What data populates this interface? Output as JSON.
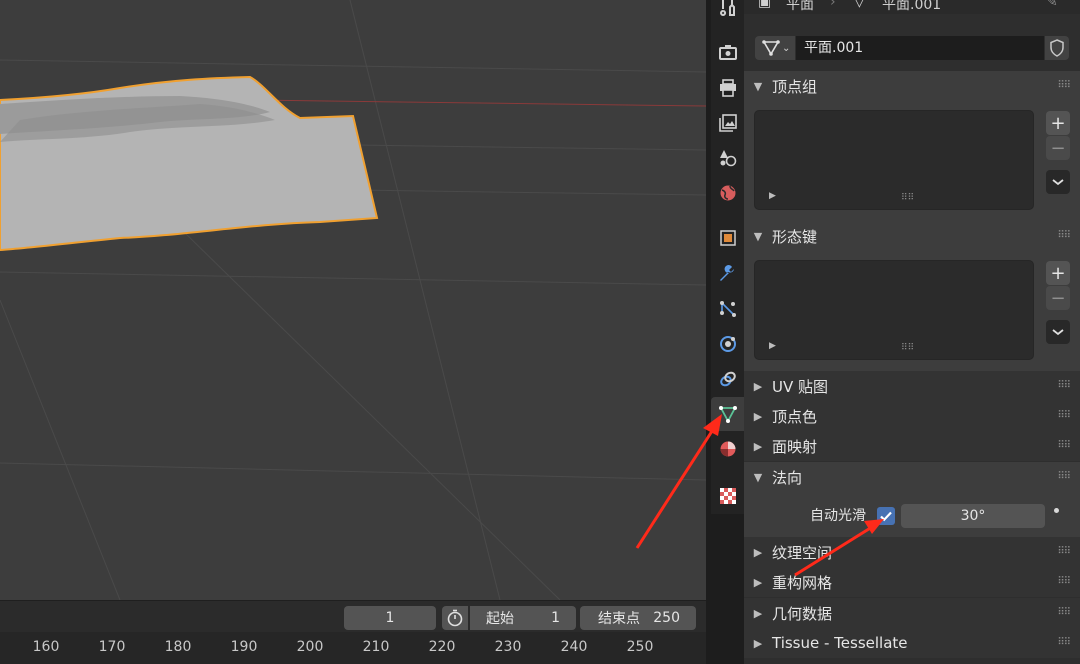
{
  "header": {
    "object_name": "平面",
    "mesh_name": "平面.001"
  },
  "mesh_selector": {
    "type_icon": "mesh-data-icon",
    "name": "平面.001",
    "fake_user_icon": "shield-icon"
  },
  "tabs": [
    {
      "name": "tool-tab",
      "icon": "tool-icon",
      "color": "#d0d0d0"
    },
    {
      "name": "render-tab",
      "icon": "camera-back-icon",
      "color": "#d0d0d0"
    },
    {
      "name": "output-tab",
      "icon": "printer-icon",
      "color": "#d0d0d0"
    },
    {
      "name": "view-layer-tab",
      "icon": "image-stack-icon",
      "color": "#d0d0d0"
    },
    {
      "name": "scene-tab",
      "icon": "scene-shapes-icon",
      "color": "#d0d0d0"
    },
    {
      "name": "world-tab",
      "icon": "globe-icon",
      "color": "#d75d5d"
    },
    {
      "name": "object-tab",
      "icon": "square-object-icon",
      "color": "#e08a3a"
    },
    {
      "name": "modifier-tab",
      "icon": "wrench-icon",
      "color": "#5c9ae6"
    },
    {
      "name": "particles-tab",
      "icon": "particles-icon",
      "color": "#5c9ae6"
    },
    {
      "name": "physics-tab",
      "icon": "physics-orbit-icon",
      "color": "#5c9ae6"
    },
    {
      "name": "constraints-tab",
      "icon": "constraint-icon",
      "color": "#5c9ae6"
    },
    {
      "name": "data-tab",
      "icon": "triangle-mesh-icon",
      "color": "#5bc396",
      "active": true
    },
    {
      "name": "material-tab",
      "icon": "material-sphere-icon",
      "color": "#e05a5a"
    },
    {
      "name": "texture-tab",
      "icon": "checker-texture-icon",
      "color": "#d95b5b"
    }
  ],
  "panels": {
    "vertex_groups": {
      "label": "顶点组",
      "open": true
    },
    "shape_keys": {
      "label": "形态键",
      "open": true
    },
    "uv_maps": {
      "label": "UV 贴图",
      "open": false
    },
    "vertex_colors": {
      "label": "顶点色",
      "open": false
    },
    "face_maps": {
      "label": "面映射",
      "open": false
    },
    "normals": {
      "label": "法向",
      "open": true
    },
    "texture_space": {
      "label": "纹理空间",
      "open": false
    },
    "remesh": {
      "label": "重构网格",
      "open": false
    },
    "geometry_data": {
      "label": "几何数据",
      "open": false
    },
    "tissue": {
      "label": "Tissue - Tessellate",
      "open": false
    }
  },
  "normals": {
    "auto_smooth_label": "自动光滑",
    "auto_smooth_checked": true,
    "angle": "30°"
  },
  "list_buttons": {
    "add": "+",
    "remove": "−"
  },
  "timeline": {
    "current_frame": "1",
    "start_label": "起始",
    "start_value": "1",
    "end_label": "结束点",
    "end_value": "250",
    "ruler_ticks": [
      "160",
      "170",
      "180",
      "190",
      "200",
      "210",
      "220",
      "230",
      "240",
      "250"
    ]
  },
  "colors": {
    "accent": "#4772b3",
    "selection_outline": "#f0a030",
    "annotation_arrow": "#ff2a1a"
  }
}
